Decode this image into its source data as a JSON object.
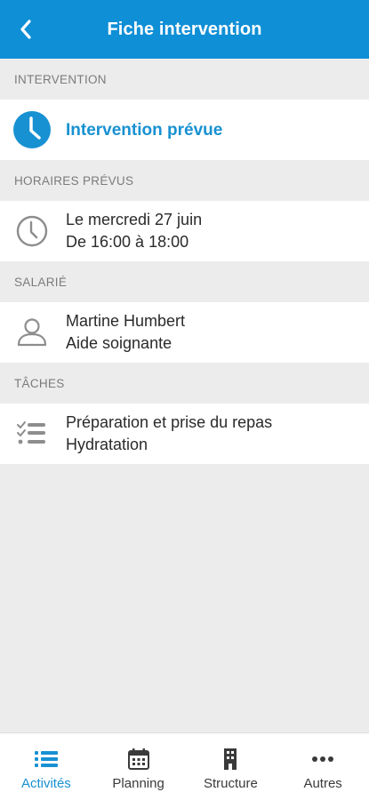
{
  "header": {
    "title": "Fiche intervention",
    "back_icon": "chevron-left-icon"
  },
  "colors": {
    "brand": "#0f8fd6",
    "accent": "#1891d2",
    "background": "#ececec"
  },
  "sections": {
    "intervention": {
      "label": "INTERVENTION",
      "status": "Intervention prévue",
      "icon": "clock-filled-icon"
    },
    "horaires": {
      "label": "HORAIRES PRÉVUS",
      "date": "Le mercredi 27 juin",
      "time": "De 16:00 à 18:00",
      "icon": "clock-outline-icon"
    },
    "salarie": {
      "label": "SALARIÉ",
      "name": "Martine Humbert",
      "role": "Aide soignante",
      "icon": "user-icon"
    },
    "taches": {
      "label": "TÂCHES",
      "items": [
        "Préparation et prise du repas",
        "Hydratation"
      ],
      "icon": "checklist-icon"
    }
  },
  "tabbar": {
    "tabs": [
      {
        "label": "Activités",
        "icon": "list-icon",
        "active": true
      },
      {
        "label": "Planning",
        "icon": "calendar-icon",
        "active": false
      },
      {
        "label": "Structure",
        "icon": "building-icon",
        "active": false
      },
      {
        "label": "Autres",
        "icon": "more-icon",
        "active": false
      }
    ]
  }
}
